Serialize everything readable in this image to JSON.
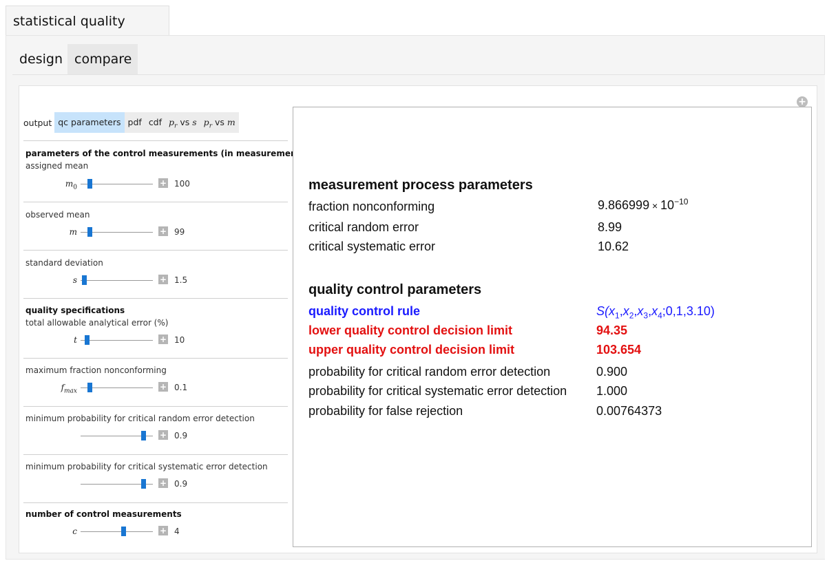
{
  "outer_tab": "statistical quality control",
  "inner_tabs": {
    "design": "design",
    "compare": "compare"
  },
  "plus_icon": "+",
  "output": {
    "label": "output",
    "options": [
      "qc parameters",
      "pdf",
      "cdf",
      "p",
      "r",
      "vs",
      "s",
      "m"
    ],
    "selected": "qc parameters"
  },
  "controls": {
    "measurements_heading": "parameters of the control measurements (in measurement units)",
    "assigned_mean": {
      "label": "assigned mean",
      "symbol": "m",
      "sub": "0",
      "value": "100",
      "level": 0.1
    },
    "observed_mean": {
      "label": "observed mean",
      "symbol": "m",
      "value": "99",
      "level": 0.1
    },
    "std_dev": {
      "label": "standard deviation",
      "symbol": "s",
      "value": "1.5",
      "level": 0.02
    },
    "quality_heading": "quality specifications",
    "tae": {
      "label": "total allowable analytical error (%)",
      "symbol": "t",
      "value": "10",
      "level": 0.06
    },
    "fmax": {
      "label": "maximum fraction nonconforming",
      "symbol": "f",
      "sub": "max",
      "value": "0.1",
      "level": 0.1
    },
    "p_random": {
      "label": "minimum probability for critical random  error detection",
      "value": "0.9",
      "level": 0.9
    },
    "p_systematic": {
      "label": "minimum probability for critical systematic error detection",
      "value": "0.9",
      "level": 0.9
    },
    "n_heading": "number of control measurements",
    "n_control": {
      "symbol": "c",
      "value": "4",
      "level": 0.6
    }
  },
  "results": {
    "process_heading": "measurement process parameters",
    "fraction_nonconforming": {
      "label": "fraction nonconforming",
      "mantissa": "9.866999",
      "times": "×",
      "base": "10",
      "exponent": "−10"
    },
    "critical_random_error": {
      "label": "critical random error",
      "value": "8.99"
    },
    "critical_systematic_error": {
      "label": "critical systematic error",
      "value": "10.62"
    },
    "qc_heading": "quality control parameters",
    "qc_rule": {
      "label": "quality control rule",
      "S": "S(",
      "x": "x",
      "subs": [
        "1",
        "2",
        "3",
        "4"
      ],
      "tail": ";0,1,3.10)"
    },
    "lower_limit": {
      "label": "lower quality control decision limit",
      "value": "94.35"
    },
    "upper_limit": {
      "label": "upper quality control decision limit",
      "value": "103.654"
    },
    "p_random_detection": {
      "label": "probability for critical random error detection",
      "value": "0.900"
    },
    "p_systematic_detection": {
      "label": "probability for critical systematic error detection",
      "value": "1.000"
    },
    "p_false_rejection": {
      "label": "probability for false rejection",
      "value": "0.00764373"
    }
  },
  "colors": {
    "accent_blue": "#1a1aff",
    "accent_red": "#e31010",
    "selected_tab": "#c7e3fb",
    "thumb": "#1976d2"
  }
}
